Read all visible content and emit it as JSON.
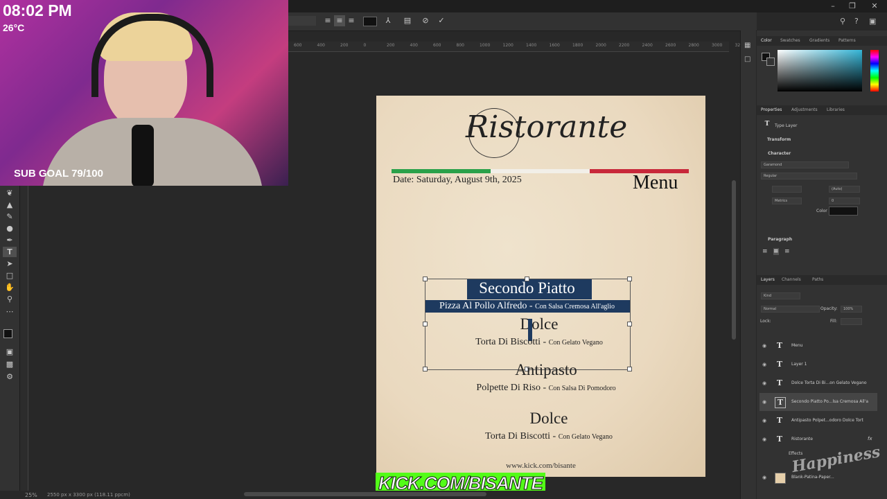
{
  "stream": {
    "clock": "08:02 PM",
    "temperature": "26°C",
    "sub_goal": "SUB GOAL 79/100",
    "kick_prefix": "K",
    "kick_rest": "ICK.COM/BISANTE",
    "happiness_watermark": "Happiness"
  },
  "ruler": {
    "ticks": [
      "600",
      "400",
      "200",
      "0",
      "200",
      "400",
      "600",
      "800",
      "1000",
      "1200",
      "1400",
      "1600",
      "1800",
      "2000",
      "2200",
      "2400",
      "2600",
      "2800",
      "3000",
      "3200"
    ]
  },
  "document": {
    "brand": "Ristorante",
    "date": "Date: Saturday, August 9th, 2025",
    "menu_title": "Menu",
    "website": "www.kick.com/bisante",
    "flag_colors": [
      "#2aa14a",
      "#f2efe8",
      "#c8283a"
    ],
    "sections": [
      {
        "title": "Secondo Piatto",
        "dish": "Pizza Al Pollo Alfredo - ",
        "note": "Con Salsa Cremosa All'aglio"
      },
      {
        "title": "Dolce",
        "dish": "Torta Di Biscotti - ",
        "note": "Con Gelato Vegano"
      },
      {
        "title": "Antipasto",
        "dish": "Polpette Di Riso - ",
        "note": "Con Salsa Di Pomodoro"
      },
      {
        "title": "Dolce",
        "dish": "Torta Di Biscotti - ",
        "note": "Con Gelato Vegano"
      }
    ]
  },
  "status_bar": {
    "zoom": "25%",
    "dimensions": "2550 px x 3300 px (118.11 ppcm)"
  },
  "panels": {
    "color_tabs": [
      "Color",
      "Swatches",
      "Gradients",
      "Patterns"
    ],
    "properties_tabs": [
      "Properties",
      "Adjustments",
      "Libraries"
    ],
    "layer_kind": "Type Layer",
    "transform_label": "Transform",
    "character_label": "Character",
    "font_family": "Garamond",
    "font_style": "Regular",
    "leading": "(Auto)",
    "kerning": "Metrics",
    "tracking": "0",
    "color_label": "Color",
    "paragraph_label": "Paragraph",
    "layers_tabs": [
      "Layers",
      "Channels",
      "Paths"
    ],
    "layers_search": "Kind",
    "blend_mode": "Normal",
    "opacity_label": "Opacity:",
    "opacity_value": "100%",
    "lock_label": "Lock:",
    "fill_label": "Fill:",
    "effects_label": "Effects",
    "layers": [
      {
        "name": "Menu",
        "type": "T"
      },
      {
        "name": "Layer 1",
        "type": "T"
      },
      {
        "name": "Dolce Torta Di Bi...on Gelato Vegano",
        "type": "T"
      },
      {
        "name": "Secondo Piatto Po...lsa Cremosa All'a",
        "type": "T"
      },
      {
        "name": "Antipasto  Polpet...odoro  Dolce Tort",
        "type": "T"
      },
      {
        "name": "Ristorante",
        "type": "T"
      },
      {
        "name": "Blank-Patina-Paper...",
        "type": "img"
      }
    ]
  }
}
